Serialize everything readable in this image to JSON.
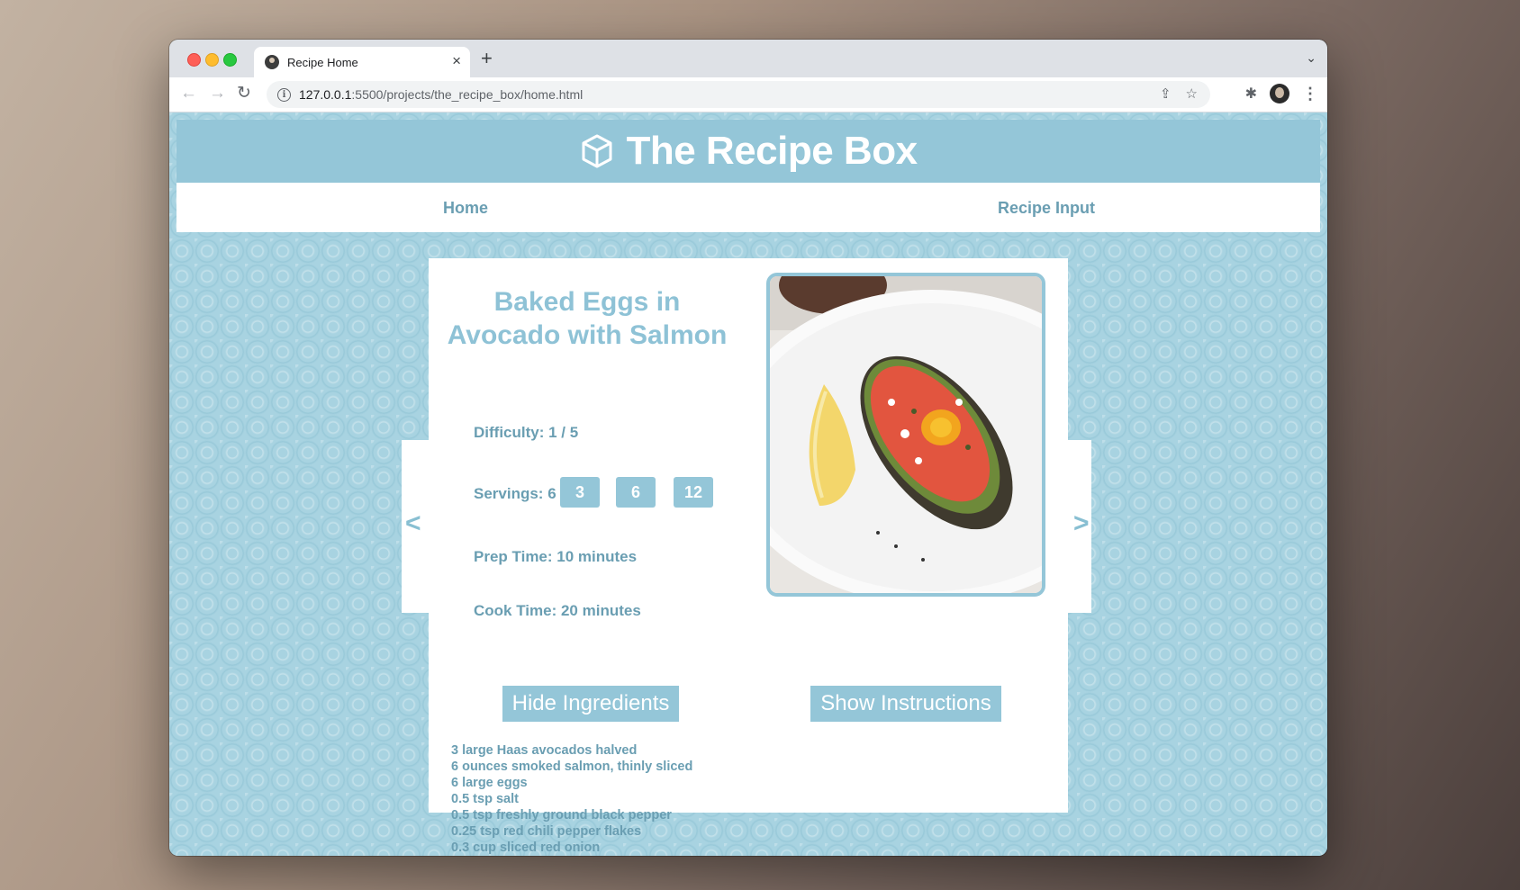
{
  "browser": {
    "tab_title": "Recipe Home",
    "url_host": "127.0.0.1",
    "url_rest": ":5500/projects/the_recipe_box/home.html"
  },
  "site": {
    "title": "The Recipe Box",
    "nav": [
      "Home",
      "Recipe Input"
    ]
  },
  "recipe": {
    "title": "Baked Eggs in Avocado with Salmon",
    "difficulty": "Difficulty: 1 / 5",
    "servings_label": "Servings: 6",
    "serving_options": [
      "3",
      "6",
      "12"
    ],
    "prep_time": "Prep Time: 10 minutes",
    "cook_time": "Cook Time: 20 minutes",
    "prev_arrow": "<",
    "next_arrow": ">",
    "hide_ingredients_label": "Hide Ingredients",
    "show_instructions_label": "Show Instructions",
    "ingredients": [
      "3 large Haas avocados halved",
      "6 ounces smoked salmon, thinly sliced",
      "6 large eggs",
      "0.5 tsp salt",
      "0.5 tsp freshly ground black pepper",
      "0.25 tsp red chili pepper flakes",
      "0.3 cup sliced red onion"
    ]
  },
  "colors": {
    "accent": "#94c6d8",
    "text": "#6a9eb2",
    "background": "#a8d3e1"
  }
}
